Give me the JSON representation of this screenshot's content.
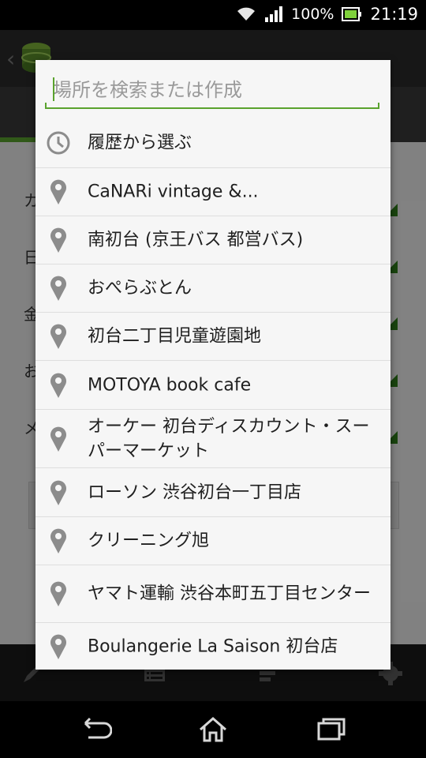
{
  "status_bar": {
    "battery": "100%",
    "time": "21:19"
  },
  "search": {
    "placeholder": "場所を検索または作成",
    "value": ""
  },
  "history_item": {
    "label": "履歴から選ぶ",
    "icon": "clock-icon"
  },
  "places": [
    {
      "label": "CaNARi vintage &..."
    },
    {
      "label": "南初台 (京王バス 都営バス)"
    },
    {
      "label": "おぺらぶとん"
    },
    {
      "label": "初台二丁目児童遊園地"
    },
    {
      "label": "MOTOYA book cafe"
    },
    {
      "label": "オーケー 初台ディスカウント・スーパーマーケット"
    },
    {
      "label": "ローソン 渋谷初台一丁目店"
    },
    {
      "label": "クリーニング旭"
    },
    {
      "label": "ヤマト運輸 渋谷本町五丁目センター"
    },
    {
      "label": "Boulangerie La Saison 初台店"
    }
  ],
  "background_app": {
    "row_labels": [
      "カ",
      "日",
      "金",
      "お",
      "メ"
    ]
  },
  "colors": {
    "accent": "#5aa32e",
    "dialog_bg": "#f6f6f6",
    "icon_gray": "#8c8c8c"
  }
}
